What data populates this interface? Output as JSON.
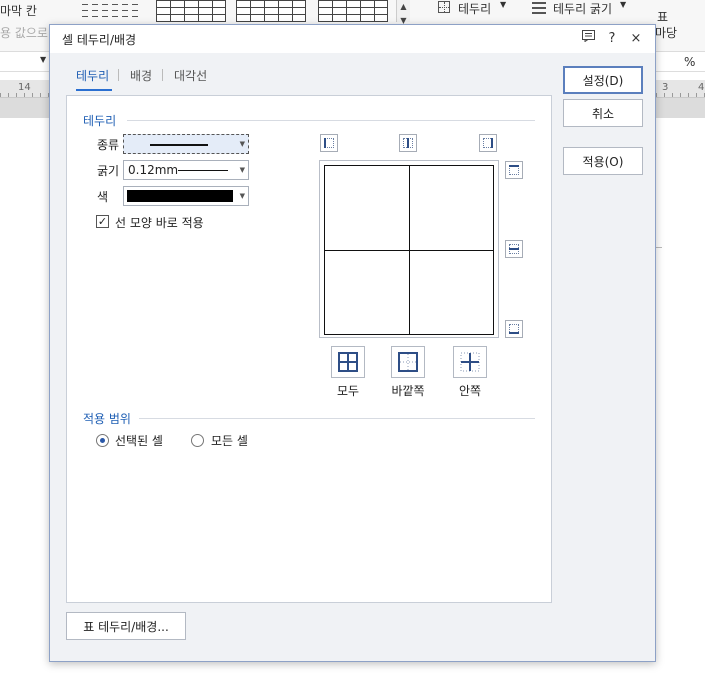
{
  "background": {
    "ribbon_left_1": "마막 칸",
    "ribbon_left_2": "용 값으로",
    "border_menu": "테두리",
    "border_weight_menu": "테두리 굵기",
    "table_label": "표",
    "table_label_2": "마당",
    "percent": "%",
    "ruler_left": "14",
    "ruler_right_1": "3",
    "ruler_right_2": "4"
  },
  "dialog": {
    "title": "셀 테두리/배경",
    "memo_icon": "memo-icon",
    "help": "?",
    "close": "×",
    "tabs": [
      "테두리",
      "배경",
      "대각선"
    ],
    "active_tab": 0,
    "border_group": {
      "title": "테두리",
      "type_label": "종류",
      "weight_label": "굵기",
      "weight_value": "0.12mm",
      "color_label": "색",
      "color_value": "#000000",
      "apply_line_shape": "선 모양 바로 적용",
      "apply_line_shape_checked": true
    },
    "presets": [
      {
        "label": "모두",
        "icon": "all-borders-icon"
      },
      {
        "label": "바깥쪽",
        "icon": "outer-borders-icon"
      },
      {
        "label": "안쪽",
        "icon": "inner-borders-icon"
      }
    ],
    "scope_group": {
      "title": "적용 범위",
      "options": [
        "선택된 셀",
        "모든 셀"
      ],
      "selected": 0
    },
    "buttons": {
      "ok": "설정(D)",
      "cancel": "취소",
      "apply": "적용(O)",
      "table_border": "표 테두리/배경..."
    },
    "accent_color": "#1f5fb4"
  }
}
